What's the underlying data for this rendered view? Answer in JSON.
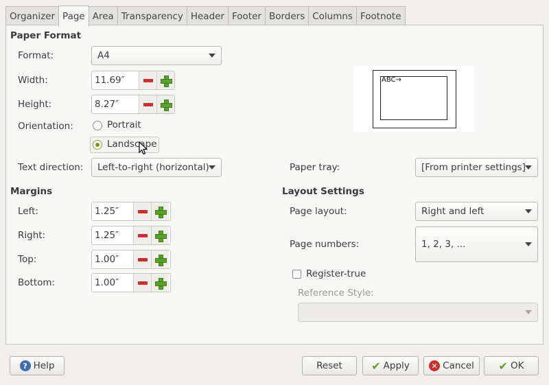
{
  "tabs": [
    {
      "label": "Organizer"
    },
    {
      "label": "Page"
    },
    {
      "label": "Area"
    },
    {
      "label": "Transparency"
    },
    {
      "label": "Header"
    },
    {
      "label": "Footer"
    },
    {
      "label": "Borders"
    },
    {
      "label": "Columns"
    },
    {
      "label": "Footnote"
    }
  ],
  "active_tab": "Page",
  "paper_format": {
    "heading": "Paper Format",
    "format_label": "Format:",
    "format_value": "A4",
    "width_label": "Width:",
    "width_value": "11.69″",
    "height_label": "Height:",
    "height_value": "8.27″",
    "orientation_label": "Orientation:",
    "portrait_label": "Portrait",
    "landscape_label": "Landscape",
    "orientation_selected": "Landscape",
    "text_direction_label": "Text direction:",
    "text_direction_value": "Left-to-right (horizontal)",
    "paper_tray_label": "Paper tray:",
    "paper_tray_value": "[From printer settings]",
    "preview_text": "ABC→"
  },
  "margins": {
    "heading": "Margins",
    "left_label": "Left:",
    "left_value": "1.25″",
    "right_label": "Right:",
    "right_value": "1.25″",
    "top_label": "Top:",
    "top_value": "1.00″",
    "bottom_label": "Bottom:",
    "bottom_value": "1.00″"
  },
  "layout_settings": {
    "heading": "Layout Settings",
    "page_layout_label": "Page layout:",
    "page_layout_value": "Right and left",
    "page_numbers_label": "Page numbers:",
    "page_numbers_value": "1, 2, 3, ...",
    "register_true_label": "Register-true",
    "register_true_checked": false,
    "reference_style_label": "Reference Style:",
    "reference_style_value": ""
  },
  "buttons": {
    "help": "Help",
    "reset": "Reset",
    "apply": "Apply",
    "cancel": "Cancel",
    "ok": "OK"
  },
  "colors": {
    "minus": "#cc2f2f",
    "plus": "#5aa02c",
    "radio_selected": "#6f9b1f",
    "help_icon": "#3f6fb3"
  }
}
